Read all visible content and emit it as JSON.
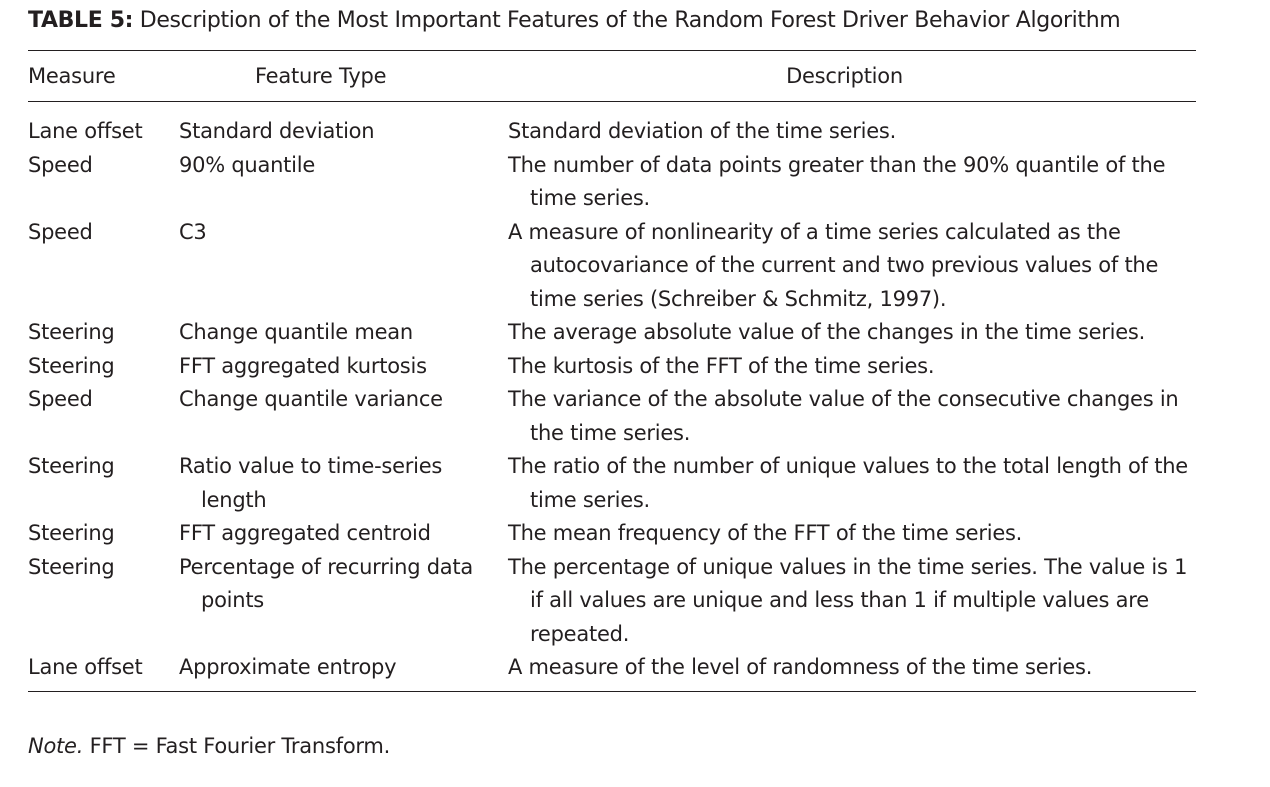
{
  "table": {
    "label": "TABLE 5:",
    "title": "Description of the Most Important Features of the Random Forest Driver Behavior Algorithm",
    "headers": {
      "measure": "Measure",
      "feature_type": "Feature Type",
      "description": "Description"
    },
    "rows": [
      {
        "measure": "Lane offset",
        "feature_type": "Standard deviation",
        "description": "Standard deviation of the time series."
      },
      {
        "measure": "Speed",
        "feature_type": "90% quantile",
        "description": "The number of data points greater than the 90% quantile of the time series."
      },
      {
        "measure": "Speed",
        "feature_type": "C3",
        "description": "A measure of nonlinearity of a time series calculated as the autocovariance of the current and two previous values of the time series (Schreiber & Schmitz, 1997)."
      },
      {
        "measure": "Steering",
        "feature_type": "Change quantile mean",
        "description": "The average absolute value of the changes in the time series."
      },
      {
        "measure": "Steering",
        "feature_type": "FFT aggregated kurtosis",
        "description": "The kurtosis of the FFT of the time series."
      },
      {
        "measure": "Speed",
        "feature_type": "Change quantile variance",
        "description": "The variance of the absolute value of the consecutive changes in the time series."
      },
      {
        "measure": "Steering",
        "feature_type": "Ratio value to time-series length",
        "description": "The ratio of the number of unique values to the total length of the time series."
      },
      {
        "measure": "Steering",
        "feature_type": "FFT aggregated centroid",
        "description": "The mean frequency of the FFT of the time series."
      },
      {
        "measure": "Steering",
        "feature_type": "Percentage of recurring data points",
        "description": "The percentage of unique values in the time series. The value is 1 if all values are unique and less than 1 if multiple values are repeated."
      },
      {
        "measure": "Lane offset",
        "feature_type": "Approximate entropy",
        "description": "A measure of the level of randomness of the time series."
      }
    ],
    "note_label": "Note.",
    "note_text": " FFT = Fast Fourier Transform."
  }
}
